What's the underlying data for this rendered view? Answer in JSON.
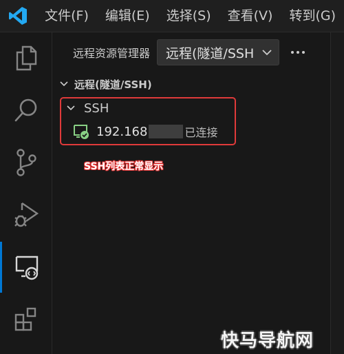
{
  "titlebar": {
    "menu": [
      "文件(F)",
      "编辑(E)",
      "选择(S)",
      "查看(V)",
      "转到(G)"
    ]
  },
  "activitybar": {
    "items": [
      "explorer-icon",
      "search-icon",
      "source-control-icon",
      "run-debug-icon",
      "remote-explorer-icon",
      "extensions-icon"
    ],
    "active": "remote-explorer-icon"
  },
  "sidebar": {
    "title": "远程资源管理器",
    "select_value": "远程(隧道/SSH",
    "section_title": "远程(隧道/SSH)",
    "group_label": "SSH",
    "host": {
      "ip": "192.168",
      "status": "已连接"
    }
  },
  "annotation": "SSH列表正常显示",
  "watermark": "快马导航网",
  "colors": {
    "accent": "#0078d4",
    "connected": "#89d185",
    "highlight_border": "#e03a3a",
    "background": "#181818"
  }
}
